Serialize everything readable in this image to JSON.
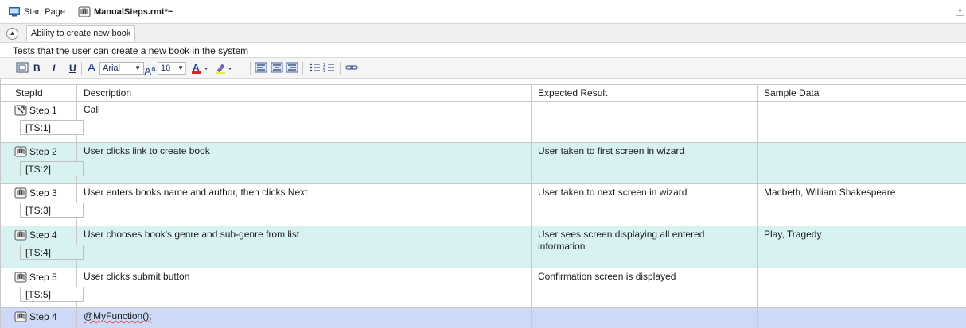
{
  "tabs": {
    "start_page": "Start Page",
    "active_file": "ManualSteps.rmt*~"
  },
  "test_case": {
    "title": "Ability to create new book",
    "description": "Tests that the user can create a new book in the system"
  },
  "toolbar": {
    "font_name": "Arial",
    "font_size": "10",
    "bold": "B",
    "italic": "I",
    "underline": "U",
    "font_label": "A"
  },
  "columns": [
    "StepId",
    "Description",
    "Expected Result",
    "Sample Data"
  ],
  "rows": [
    {
      "step": "Step 1",
      "ts": "[TS:1]",
      "icon": "call-icon",
      "description": "Call",
      "expected": "",
      "sample": ""
    },
    {
      "step": "Step 2",
      "ts": "[TS:2]",
      "icon": "manual-step-icon",
      "description": "User clicks link to create book",
      "expected": "User taken to first screen in wizard",
      "sample": ""
    },
    {
      "step": "Step 3",
      "ts": "[TS:3]",
      "icon": "manual-step-icon",
      "description": "User enters books name and author, then clicks Next",
      "expected": "User taken to next screen in wizard",
      "sample": "Macbeth, William Shakespeare"
    },
    {
      "step": "Step 4",
      "ts": "[TS:4]",
      "icon": "manual-step-icon",
      "description": "User chooses book's genre and sub-genre from list",
      "expected": "User sees screen displaying all entered information",
      "sample": "Play, Tragedy"
    },
    {
      "step": "Step 5",
      "ts": "[TS:5]",
      "icon": "manual-step-icon",
      "description": "User clicks submit button",
      "expected": "Confirmation screen is displayed",
      "sample": ""
    },
    {
      "step": "Step 4",
      "ts": "",
      "icon": "manual-step-icon",
      "description": "@MyFunction();",
      "expected": "",
      "sample": ""
    }
  ],
  "colors": {
    "alt_row": "#d8f1f1",
    "selected_row": "#cdd9f7",
    "grid_line": "#c8c8c8"
  }
}
